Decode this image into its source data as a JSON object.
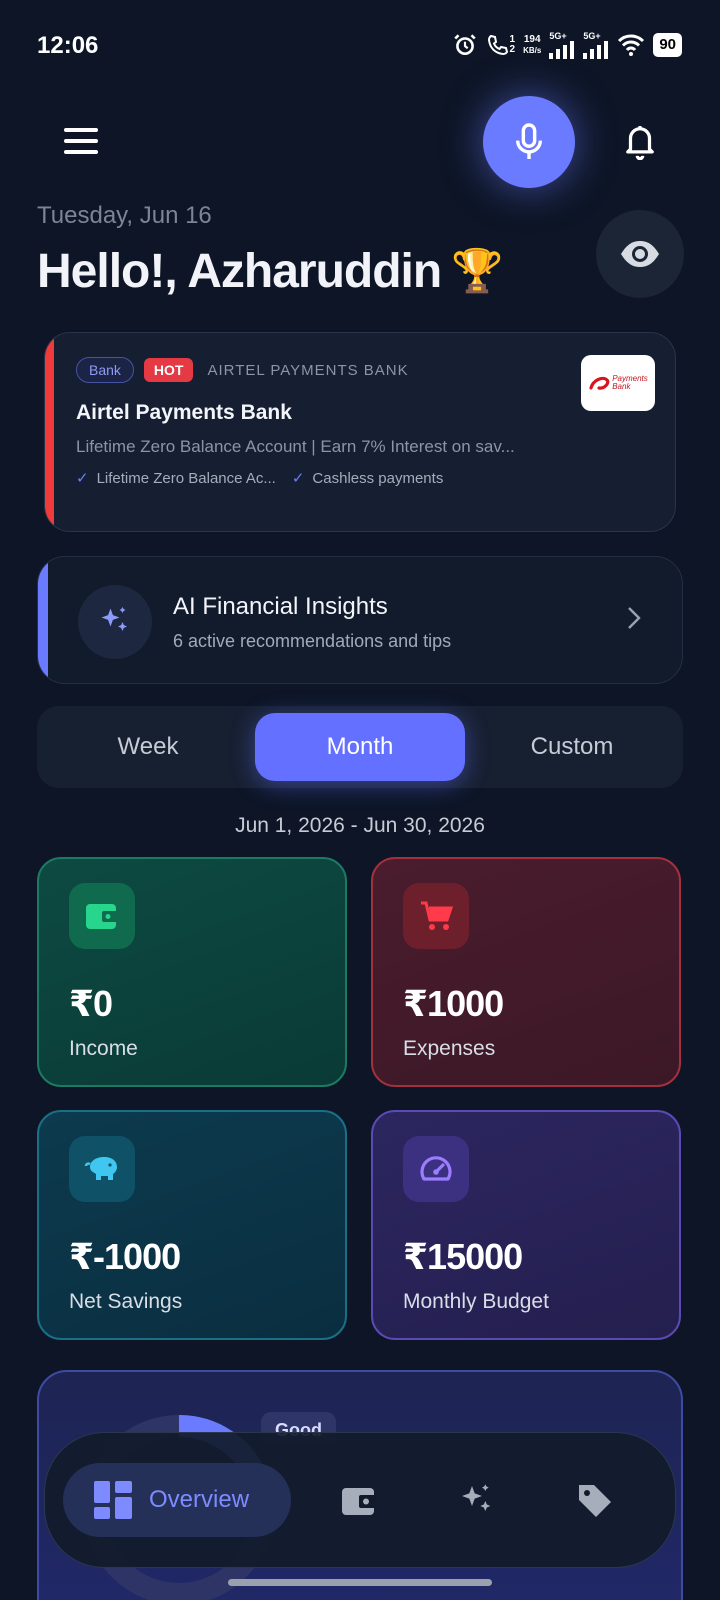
{
  "status_bar": {
    "time": "12:06",
    "net_speed_value": "194",
    "net_speed_unit": "KB/s",
    "call_sim": "1",
    "call_sim2": "2",
    "signal1_label": "5G+",
    "signal2_label": "5G+",
    "battery": "90"
  },
  "header": {
    "date": "Tuesday, Jun 16",
    "greeting": "Hello!, Azharuddin",
    "trophy": "🏆"
  },
  "bank_card": {
    "tag_type": "Bank",
    "tag_hot": "HOT",
    "provider": "AIRTEL PAYMENTS BANK",
    "title": "Airtel Payments Bank",
    "description": "Lifetime Zero Balance Account | Earn 7% Interest on sav...",
    "feature_1": "Lifetime Zero Balance Ac...",
    "feature_2": "Cashless payments",
    "logo_line1": "Payments",
    "logo_line2": "Bank",
    "accent_color": "#ef3b3b"
  },
  "ai_card": {
    "title": "AI Financial Insights",
    "subtitle": "6 active recommendations and tips",
    "accent_color": "#6b7bff"
  },
  "period_tabs": {
    "week": "Week",
    "month": "Month",
    "custom": "Custom",
    "selected": "Month"
  },
  "date_range": "Jun 1, 2026 - Jun 30, 2026",
  "stats": {
    "income": {
      "value": "₹0",
      "label": "Income",
      "icon": "wallet-icon"
    },
    "expenses": {
      "value": "₹1000",
      "label": "Expenses",
      "icon": "cart-icon"
    },
    "net_savings": {
      "value": "₹-1000",
      "label": "Net Savings",
      "icon": "piggy-bank-icon"
    },
    "budget": {
      "value": "₹15000",
      "label": "Monthly Budget",
      "icon": "speedometer-icon"
    }
  },
  "health_card": {
    "badge": "Good"
  },
  "bottom_nav": {
    "overview": "Overview",
    "items": [
      "grid-icon",
      "wallet-icon",
      "sparkles-icon",
      "tag-icon"
    ]
  },
  "colors": {
    "background": "#0d1526",
    "accent": "#6470ff",
    "income": "#1b7a62",
    "expense": "#a2313e",
    "savings": "#1a6f86",
    "budget": "#5a4ab4"
  }
}
